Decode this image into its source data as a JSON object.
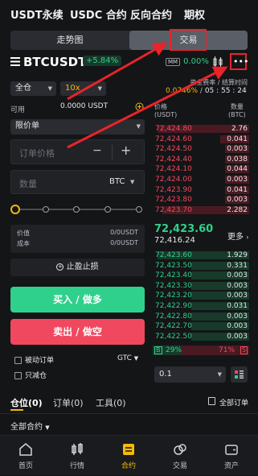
{
  "topnav": {
    "items": [
      "USDT永续",
      "USDC 合约",
      "反向合约",
      "期权"
    ]
  },
  "view_toggle": {
    "chart_label": "走势图",
    "trade_label": "交易"
  },
  "symbol": {
    "name": "BTCUSDT",
    "change": "+5.84%",
    "mm_label": "MM",
    "mm_value": "0.00%"
  },
  "funding": {
    "label": "资金费率 / 结算时间",
    "rate": "0.0746%",
    "countdown": "05 : 55 : 24"
  },
  "order": {
    "margin_mode": "全仓",
    "leverage": "10x",
    "available_label": "可用",
    "available_value": "0.0000 USDT",
    "order_type": "限价单",
    "price_placeholder": "订单价格",
    "minus": "−",
    "plus": "+",
    "qty_placeholder": "数量",
    "qty_unit": "BTC",
    "value_label": "价值",
    "value_value": "0/0USDT",
    "cost_label": "成本",
    "cost_value": "0/0USDT",
    "tpsl_label": "止盈止损",
    "buy_label": "买入 / 做多",
    "sell_label": "卖出 / 做空",
    "passive_label": "被动订单",
    "tif": "GTC",
    "reduce_label": "只减仓"
  },
  "orderbook": {
    "price_header": "价格\n(USDT)",
    "qty_header": "数量\n(BTC)",
    "asks": [
      {
        "price": "72,424.80",
        "qty": "2.76",
        "depth": 0.95
      },
      {
        "price": "72,424.60",
        "qty": "0.041",
        "depth": 0.3
      },
      {
        "price": "72,424.50",
        "qty": "0.003",
        "depth": 0.25
      },
      {
        "price": "72,424.40",
        "qty": "0.038",
        "depth": 0.25
      },
      {
        "price": "72,424.10",
        "qty": "0.044",
        "depth": 0.25
      },
      {
        "price": "72,424.00",
        "qty": "0.003",
        "depth": 0.25
      },
      {
        "price": "72,423.90",
        "qty": "0.041",
        "depth": 0.25
      },
      {
        "price": "72,423.80",
        "qty": "0.003",
        "depth": 0.25
      },
      {
        "price": "72,423.70",
        "qty": "2.282",
        "depth": 0.9
      }
    ],
    "last_price": "72,423.60",
    "mark_price": "72,416.24",
    "more_label": "更多",
    "bids": [
      {
        "price": "72,423.60",
        "qty": "1.929",
        "depth": 0.95
      },
      {
        "price": "72,423.50",
        "qty": "0.331",
        "depth": 0.6
      },
      {
        "price": "72,423.40",
        "qty": "0.003",
        "depth": 0.6
      },
      {
        "price": "72,423.30",
        "qty": "0.003",
        "depth": 0.6
      },
      {
        "price": "72,423.20",
        "qty": "0.003",
        "depth": 0.6
      },
      {
        "price": "72,422.90",
        "qty": "0.031",
        "depth": 0.6
      },
      {
        "price": "72,422.80",
        "qty": "0.003",
        "depth": 0.6
      },
      {
        "price": "72,422.70",
        "qty": "0.003",
        "depth": 0.6
      },
      {
        "price": "72,422.50",
        "qty": "0.003",
        "depth": 0.6
      }
    ],
    "buy_ratio_label": "B",
    "buy_ratio": "29%",
    "sell_ratio": "71%",
    "sell_ratio_label": "S",
    "precision": "0.1"
  },
  "bottom": {
    "tabs": [
      "仓位(0)",
      "订单(0)",
      "工具(0)"
    ],
    "all_orders": "全部订单",
    "all_contracts": "全部合约"
  },
  "tabbar": [
    "首页",
    "行情",
    "合约",
    "交易",
    "资产"
  ],
  "colors": {
    "green": "#2fd08c",
    "red": "#f0485e",
    "accent": "#f0b90b",
    "annotation": "#e8242a"
  }
}
